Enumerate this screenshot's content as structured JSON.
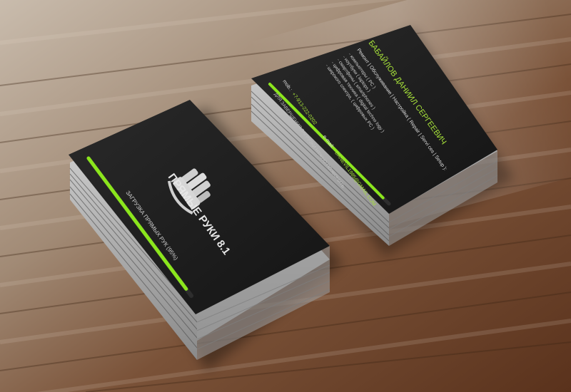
{
  "colors": {
    "accent_green": "#8be61c",
    "card_black": "#1e1e1e",
    "wood_light": "#b7a592",
    "wood_dark": "#5a341f"
  },
  "front_card": {
    "logo_icon": "hand-icon",
    "brand": "ПРЯМЫЕ РУКИ 8.1",
    "loading_text": "ЗАГРУЗКА ПРЯМЫХ РУК (95%)",
    "progress_fraction": 0.95
  },
  "back_card": {
    "name": "БАБАЙЛОВ ДАНИИЛ СЕРГЕЕВИЧ",
    "services_header": "Ремонт | Обслуживание | Настройка ( Repair | Servi ces | Setup ):",
    "services": [
      "- компьютеры ( PC )",
      "- ноутбуки ( laptops )",
      "- смартфоны ( smartphones )",
      "- цифровая техника ( digital techno logy )",
      "- широкого спектра, ( цифровых PC )"
    ],
    "phone_label": "mob.:",
    "phone": "+7-913-222-0202",
    "email_label": "e-mail:",
    "email": "DANEVIL1985@GMAIL.COM",
    "footer_note": "ДЛЯ ЗАВЕРШЕНИЯ ЗАГРУЗКИ НУЖНО ПОЗВОНИТЬ",
    "progress_fraction": 0.95
  }
}
